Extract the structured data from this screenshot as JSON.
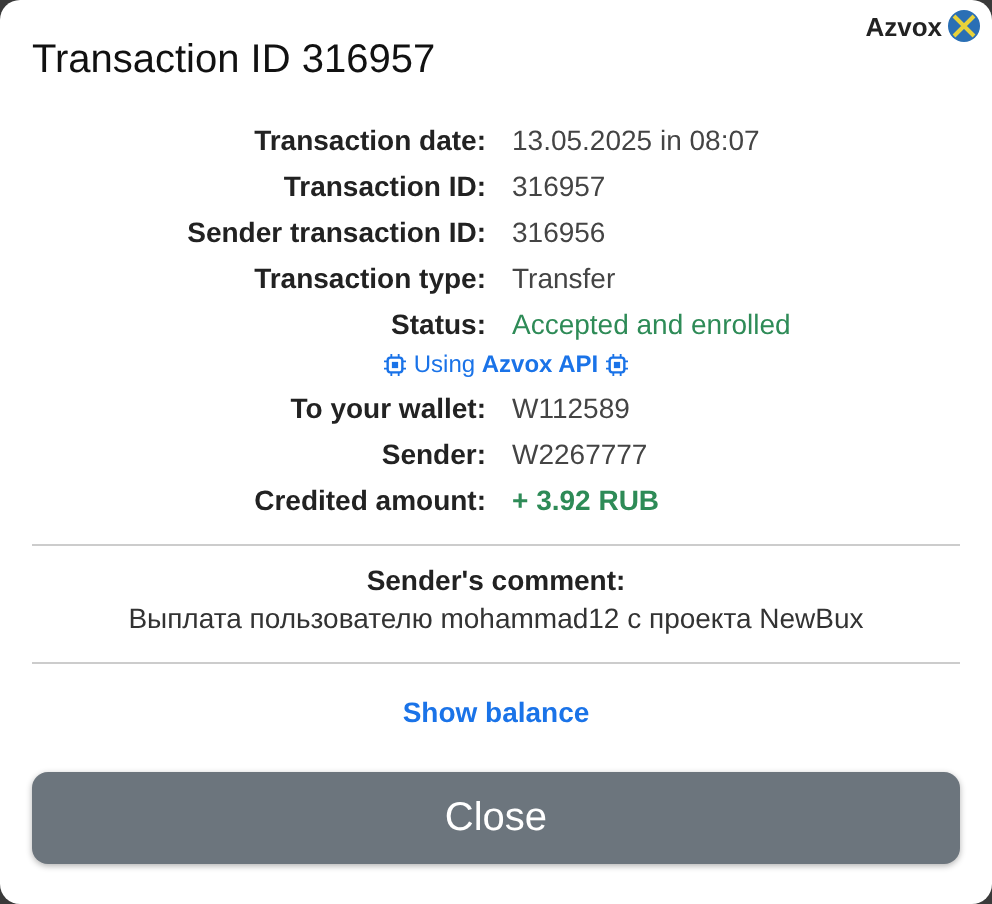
{
  "brand": {
    "name": "Azvox"
  },
  "title": "Transaction ID 316957",
  "details": [
    {
      "label": "Transaction date:",
      "value": "13.05.2025 in 08:07",
      "kind": "plain"
    },
    {
      "label": "Transaction ID:",
      "value": "316957",
      "kind": "plain"
    },
    {
      "label": "Sender transaction ID:",
      "value": "316956",
      "kind": "plain"
    },
    {
      "label": "Transaction type:",
      "value": "Transfer",
      "kind": "plain"
    },
    {
      "label": "Status:",
      "value": "Accepted and enrolled",
      "kind": "status"
    }
  ],
  "api_note": {
    "prefix": "Using",
    "name": "Azvox API"
  },
  "details_2": [
    {
      "label": "To your wallet:",
      "value": "W112589",
      "kind": "plain"
    },
    {
      "label": "Sender:",
      "value": "W2267777",
      "kind": "plain"
    },
    {
      "label": "Credited amount:",
      "value": "+ 3.92 RUB",
      "kind": "amount"
    }
  ],
  "comment": {
    "label": "Sender's comment:",
    "text": "Выплата пользователю mohammad12 с проекта NewBux"
  },
  "show_balance": "Show balance",
  "close": "Close"
}
